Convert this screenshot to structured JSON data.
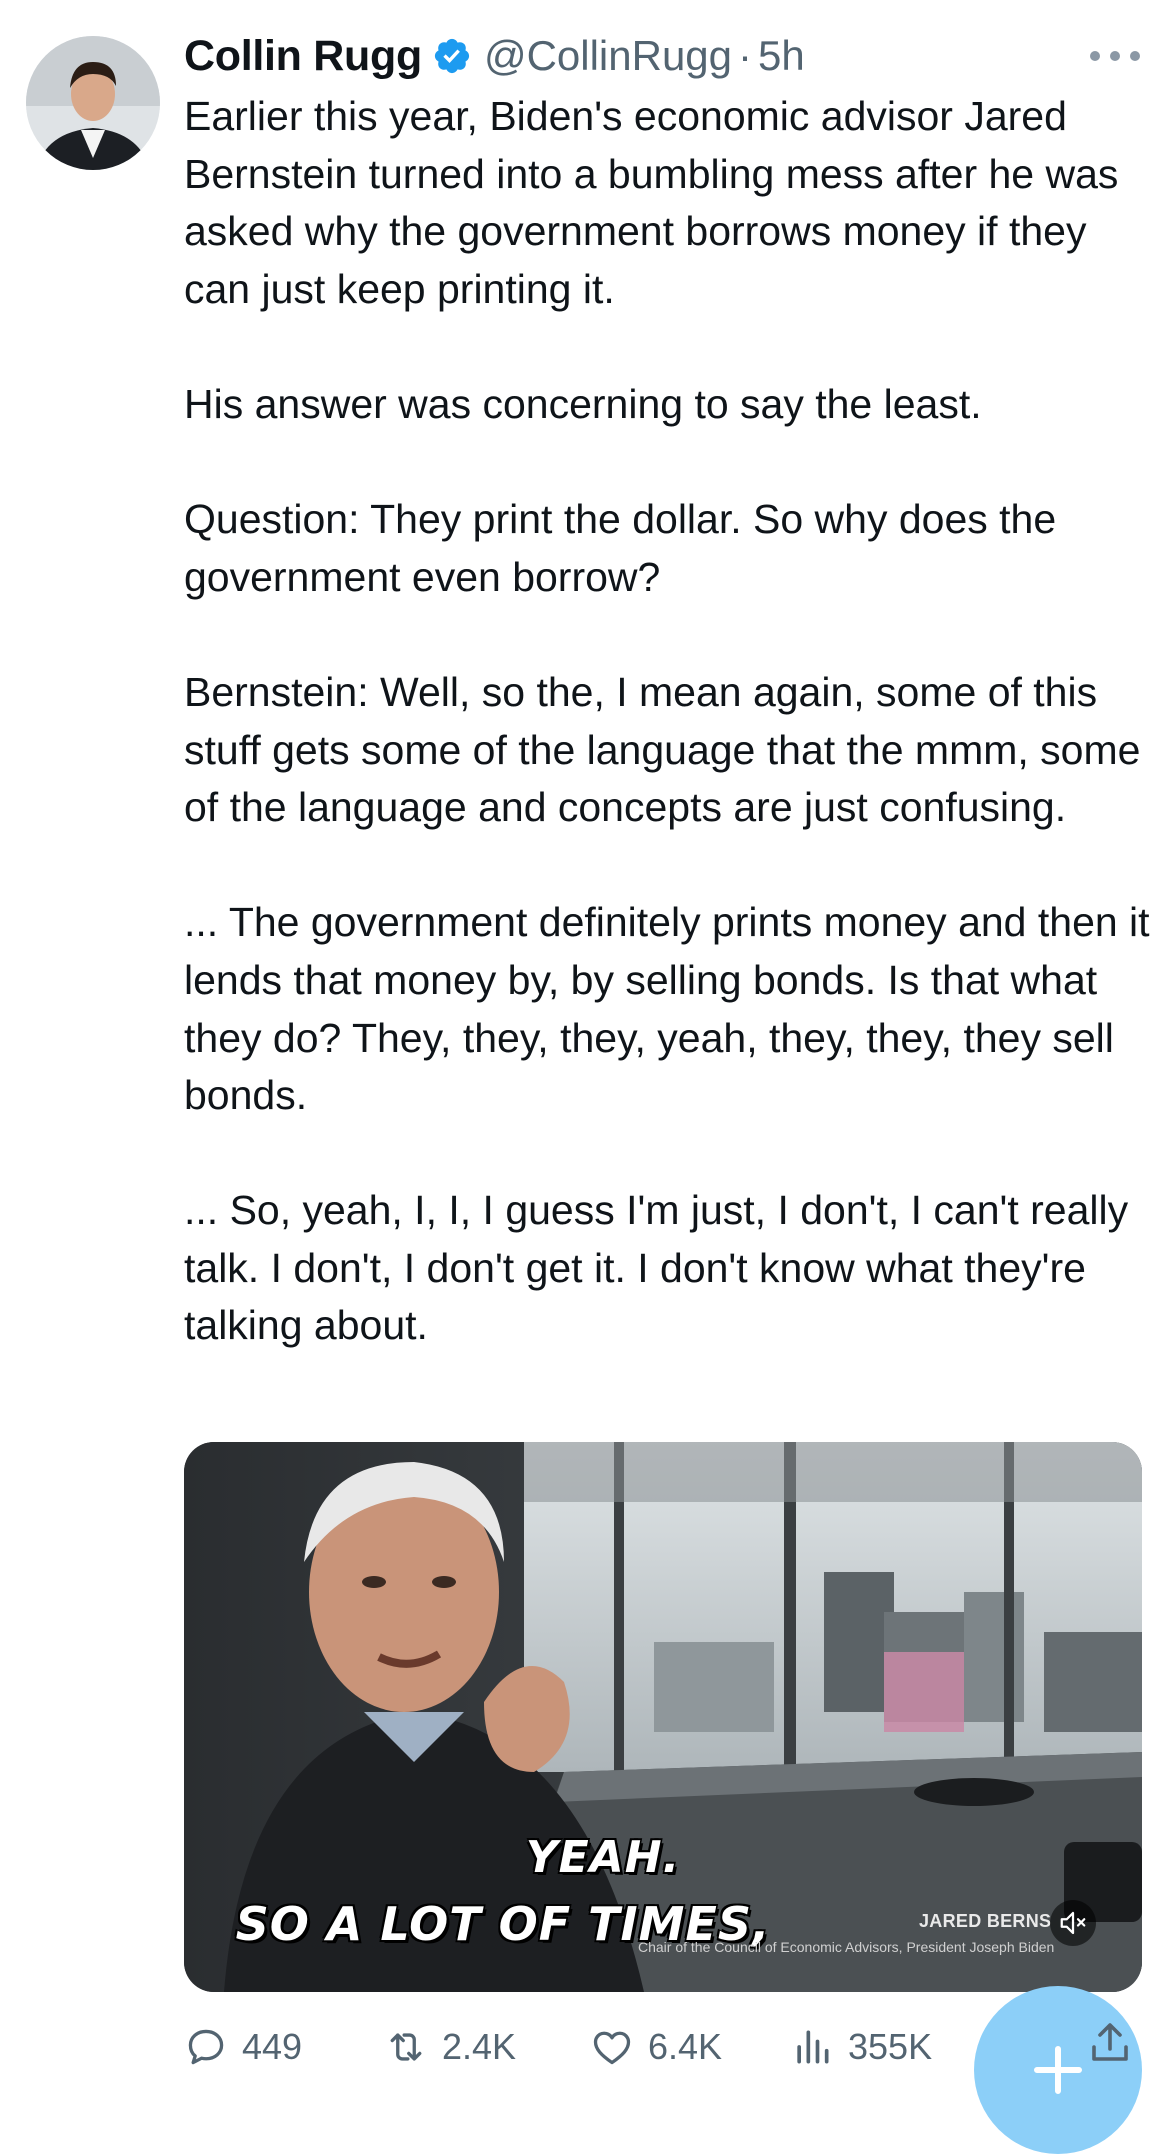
{
  "author": {
    "name": "Collin Rugg",
    "handle": "@CollinRugg",
    "separator": "·",
    "time": "5h",
    "verified_color": "#1d9bf0"
  },
  "tweet": {
    "paragraphs": [
      "Earlier this year, Biden's economic advisor Jared Bernstein turned into a bumbling mess after he was asked why the government borrows money if they can just keep printing it.",
      "His answer was concerning to say the least.",
      "Question: They print the dollar. So why does the government even borrow?",
      "Bernstein: Well, so the, I mean again, some of this stuff gets some of the language that the mmm, some of the language and concepts are just confusing.",
      "... The government definitely prints money and then it lends that money by, by selling bonds. Is that what they do? They, they, they, yeah, they, they, they sell bonds.",
      "... So, yeah, I, I, I guess I'm just, I don't, I can't really talk. I don't, I don't get it. I don't know what they're talking about."
    ]
  },
  "media": {
    "caption_line_1": "YEAH.",
    "caption_line_2": "SO A LOT OF TIMES,",
    "lower_third_name": "JARED BERNS",
    "lower_third_title": "Chair of the Council of Economic Advisors, President Joseph Biden",
    "mute_icon": "speaker-muted-icon"
  },
  "actions": {
    "replies": "449",
    "reposts": "2.4K",
    "likes": "6.4K",
    "views": "355K"
  },
  "colors": {
    "text": "#0f1419",
    "secondary": "#536471",
    "accent": "#1d9bf0",
    "fab": "#8ccff8"
  }
}
